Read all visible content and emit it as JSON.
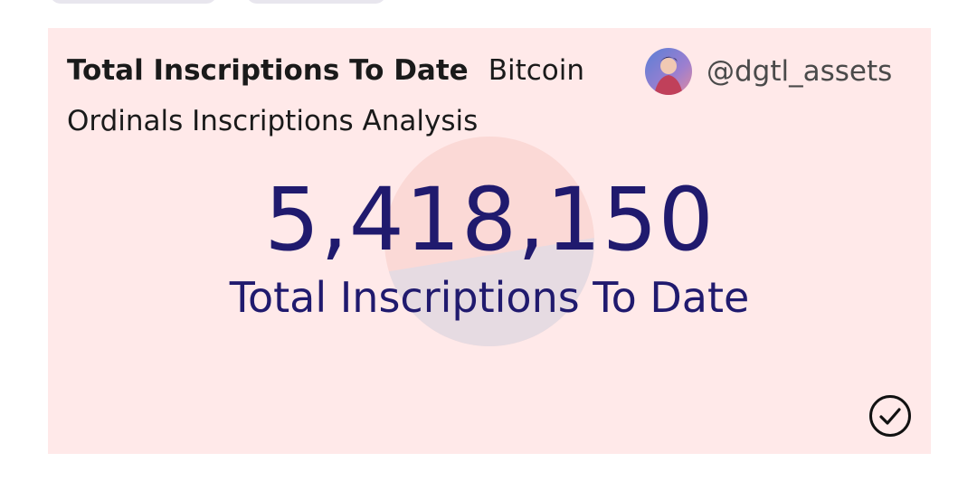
{
  "card": {
    "title": "Total Inscriptions To Date",
    "subtitle_line1": "Bitcoin",
    "subtitle_line2": "Ordinals Inscriptions Analysis",
    "author_handle": "@dgtl_assets",
    "value": "5,418,150",
    "value_label": "Total Inscriptions To Date",
    "status_icon": "check-circle-icon"
  },
  "colors": {
    "card_background": "#ffe9e9",
    "value_color": "#201a6e",
    "watermark": "#fbd9d6"
  }
}
